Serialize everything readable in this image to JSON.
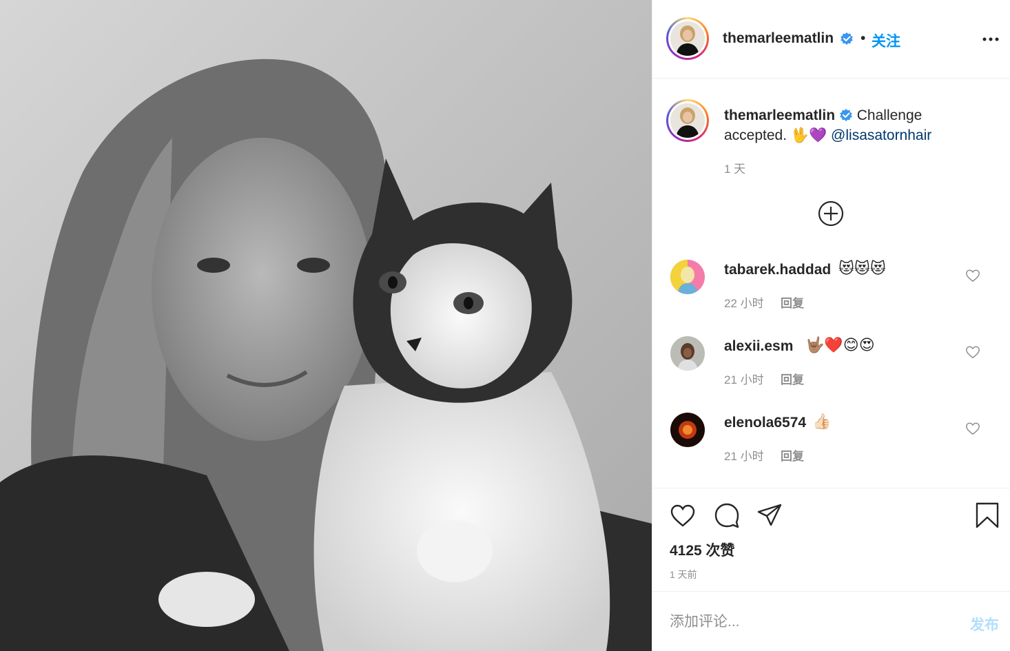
{
  "post": {
    "author": "themarleematlin",
    "follow_label": "关注",
    "separator": "•",
    "caption_text": "Challenge accepted. 🖖💜",
    "caption_mention": "@lisasatornhair",
    "caption_time": "1 天",
    "likes": "4125 次赞",
    "posted": "1 天前"
  },
  "comments": [
    {
      "user": "tabarek.haddad",
      "text": "😻😻😻",
      "time": "22 小时",
      "reply": "回复"
    },
    {
      "user": "alexii.esm",
      "text": "🤟🏽❤️😊😍",
      "time": "21 小时",
      "reply": "回复"
    },
    {
      "user": "elenola6574",
      "text": "👍🏻",
      "time": "21 小时",
      "reply": "回复"
    }
  ],
  "input": {
    "placeholder": "添加评论...",
    "post_label": "发布"
  },
  "icons": {
    "verified": "verified-badge-icon",
    "more": "more-options-icon",
    "load_more": "plus-circle-icon",
    "like": "heart-icon",
    "comment": "comment-bubble-icon",
    "share": "paper-plane-icon",
    "save": "bookmark-icon"
  },
  "colors": {
    "link": "#0095f6",
    "verified": "#3897f0",
    "mention": "#00376b",
    "muted": "#8e8e8e"
  }
}
